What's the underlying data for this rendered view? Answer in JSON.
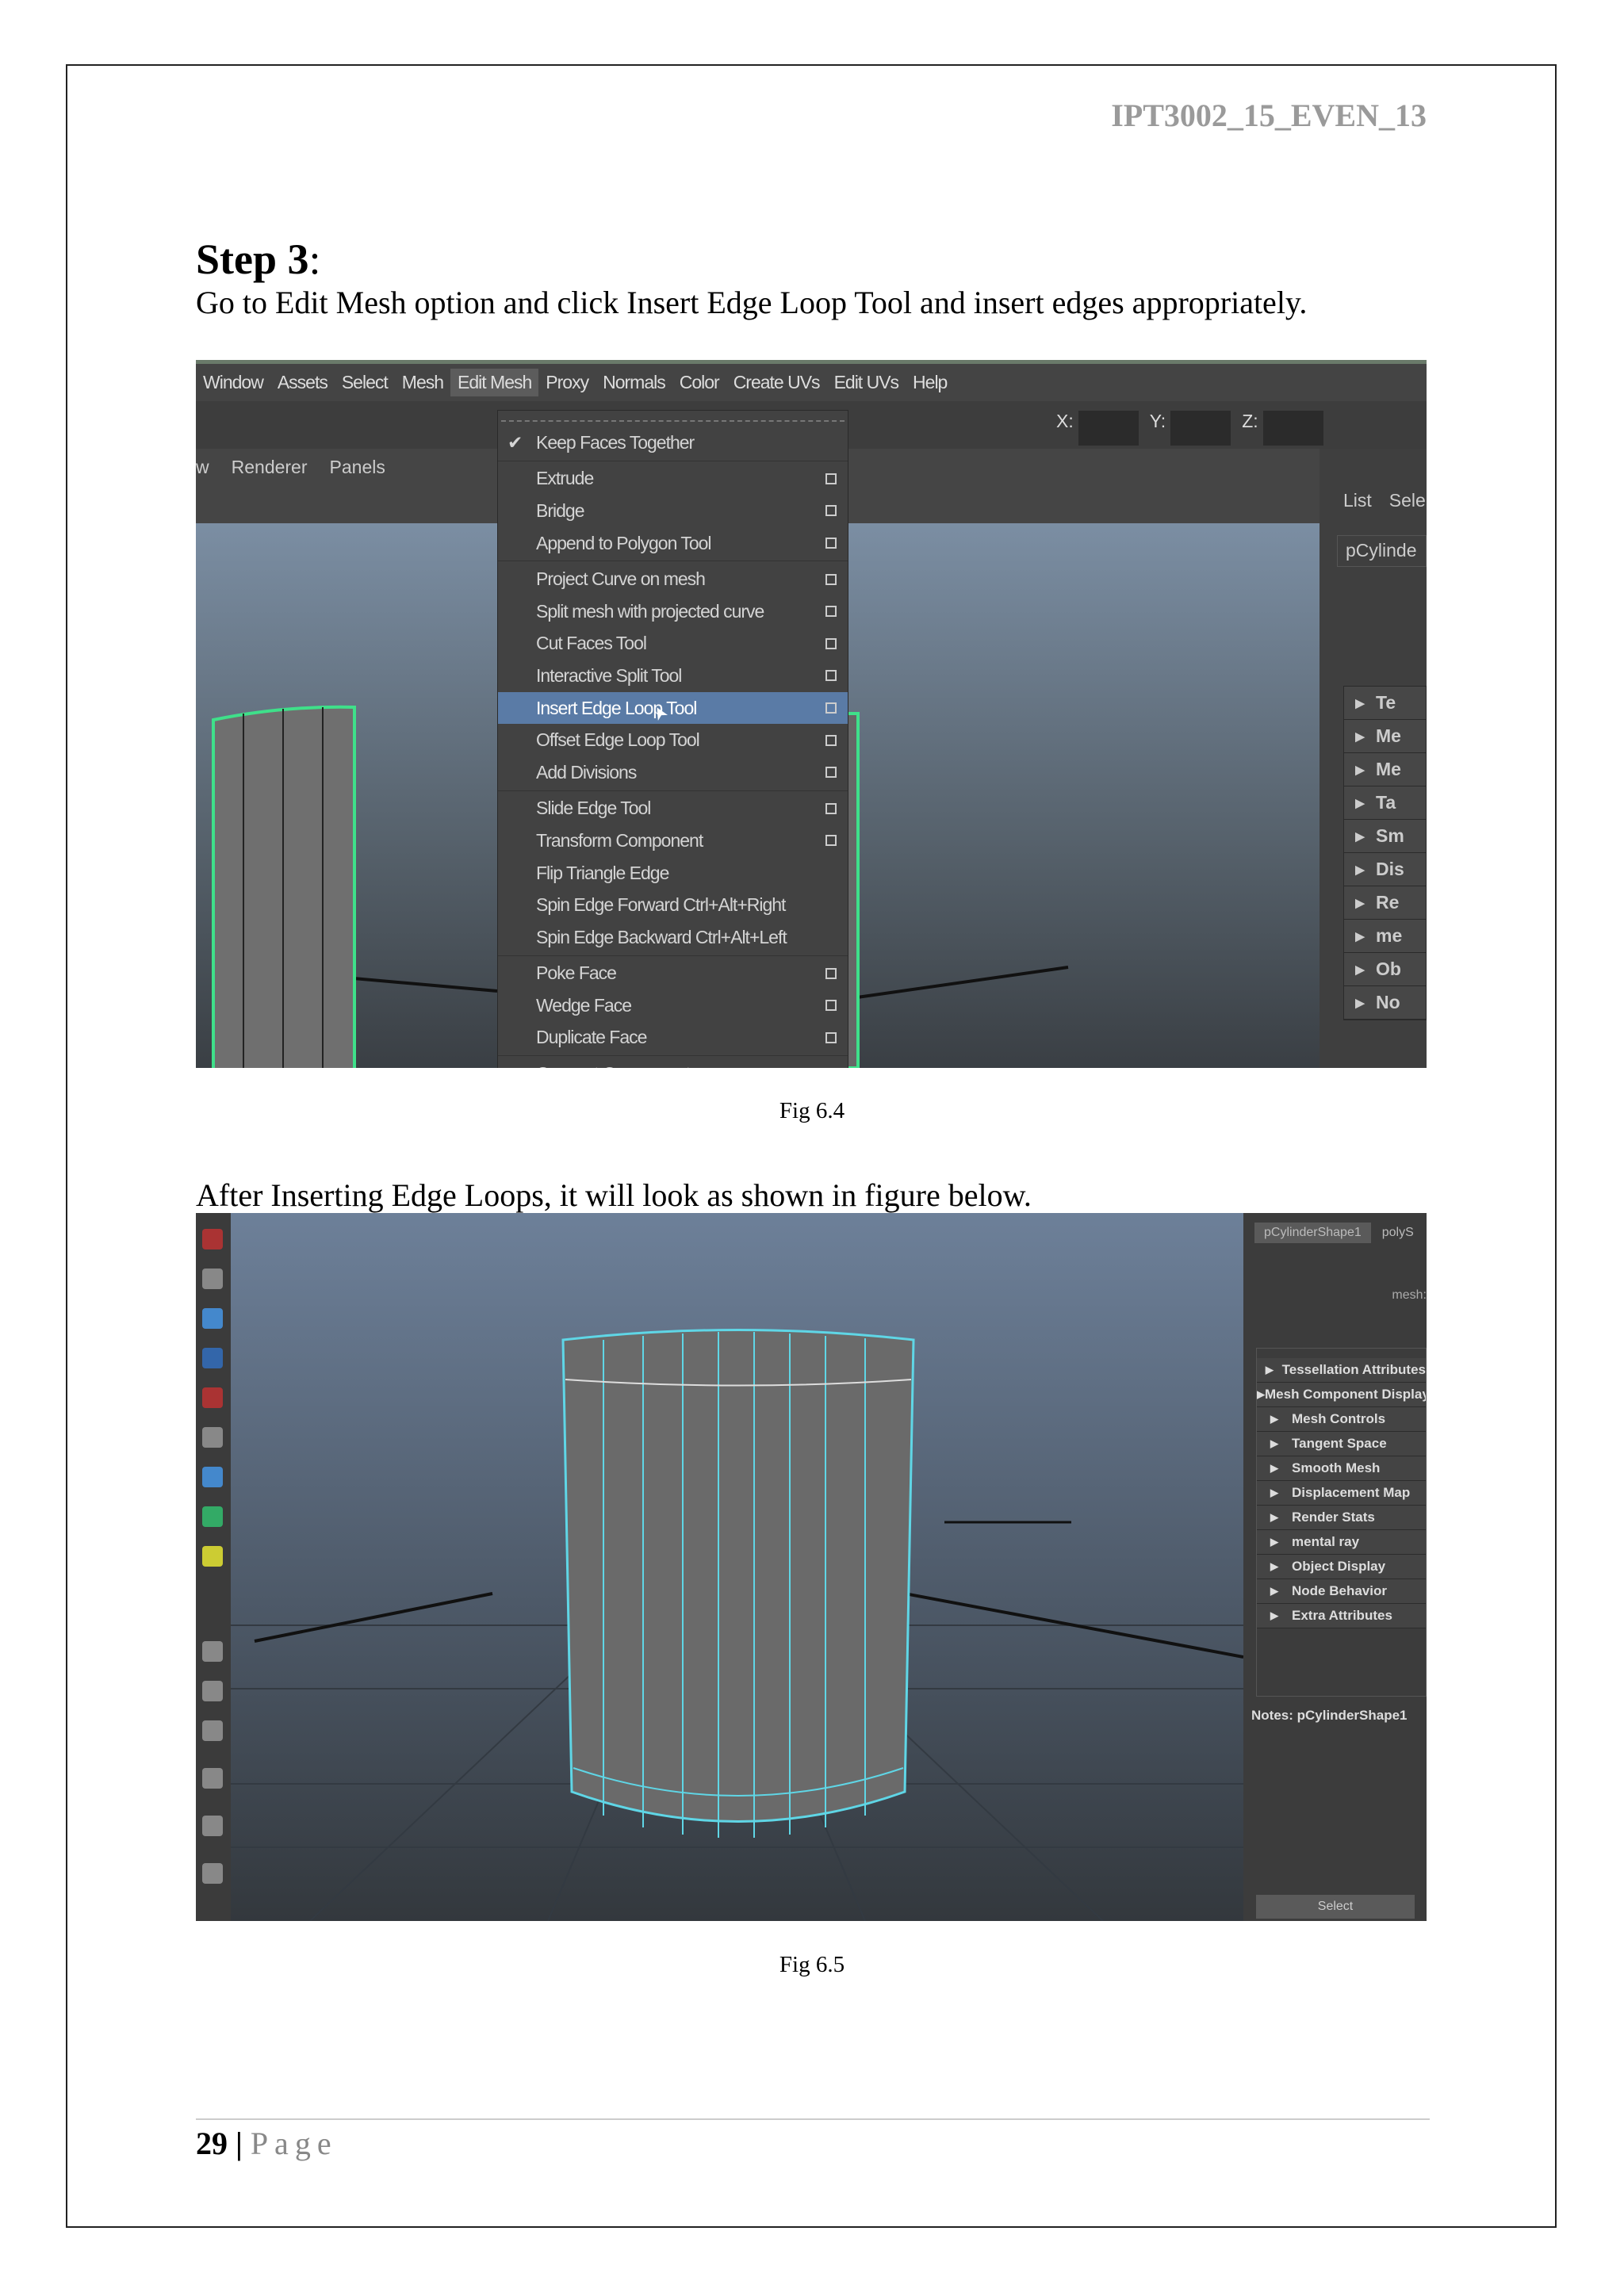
{
  "header": {
    "doc_id": "IPT3002_15_EVEN_13"
  },
  "step": {
    "title": "Step 3",
    "colon": ":",
    "instruction": "Go to Edit Mesh option and click Insert Edge Loop Tool and insert edges appropriately."
  },
  "fig1": {
    "caption": "Fig 6.4",
    "menubar": [
      "Window",
      "Assets",
      "Select",
      "Mesh",
      "Edit Mesh",
      "Proxy",
      "Normals",
      "Color",
      "Create UVs",
      "Edit UVs",
      "Help"
    ],
    "active_menu": "Edit Mesh",
    "coords": [
      "X:",
      "Y:",
      "Z:"
    ],
    "panel_menu": [
      "w",
      "Renderer",
      "Panels"
    ],
    "right_panel": {
      "tabs": [
        "List",
        "Sele"
      ],
      "node": "pCylinde",
      "rows": [
        "Te",
        "Me",
        "Me",
        "Ta",
        "Sm",
        "Dis",
        "Re",
        "me",
        "Ob",
        "No"
      ]
    },
    "dropdown": {
      "checked": "Keep Faces Together",
      "groups": [
        [
          {
            "label": "Extrude",
            "opt": true
          },
          {
            "label": "Bridge",
            "opt": true
          },
          {
            "label": "Append to Polygon Tool",
            "opt": true
          }
        ],
        [
          {
            "label": "Project Curve on mesh",
            "opt": true
          },
          {
            "label": "Split mesh with projected curve",
            "opt": true
          },
          {
            "label": "Cut Faces Tool",
            "opt": true
          },
          {
            "label": "Interactive Split Tool",
            "opt": true
          },
          {
            "label": "Insert Edge Loop Tool",
            "opt": true
          },
          {
            "label": "Offset Edge Loop Tool",
            "opt": true
          },
          {
            "label": "Add Divisions",
            "opt": true
          }
        ],
        [
          {
            "label": "Slide Edge Tool",
            "opt": true
          },
          {
            "label": "Transform Component",
            "opt": true
          },
          {
            "label": "Flip Triangle Edge",
            "opt": false
          },
          {
            "label": "Spin Edge Forward  Ctrl+Alt+Right",
            "opt": false
          },
          {
            "label": "Spin Edge Backward  Ctrl+Alt+Left",
            "opt": false
          }
        ],
        [
          {
            "label": "Poke Face",
            "opt": true
          },
          {
            "label": "Wedge Face",
            "opt": true
          },
          {
            "label": "Duplicate Face",
            "opt": true
          }
        ],
        [
          {
            "label": "Connect Components",
            "opt": false
          }
        ]
      ],
      "selected": "Insert Edge Loop Tool"
    }
  },
  "after_text": "After Inserting Edge Loops, it will look as shown in figure below.",
  "fig2": {
    "caption": "Fig 6.5",
    "tabs": [
      "pCylinderShape1",
      "polyS"
    ],
    "mesh_label": "mesh:",
    "attributes": [
      "Tessellation Attributes",
      "Mesh Component Display",
      "Mesh Controls",
      "Tangent Space",
      "Smooth Mesh",
      "Displacement Map",
      "Render Stats",
      "mental ray",
      "Object Display",
      "Node Behavior",
      "Extra Attributes"
    ],
    "notes": "Notes:  pCylinderShape1",
    "select_btn": "Select"
  },
  "footer": {
    "page_number": "29",
    "sep": "|",
    "page_label": "Page"
  }
}
